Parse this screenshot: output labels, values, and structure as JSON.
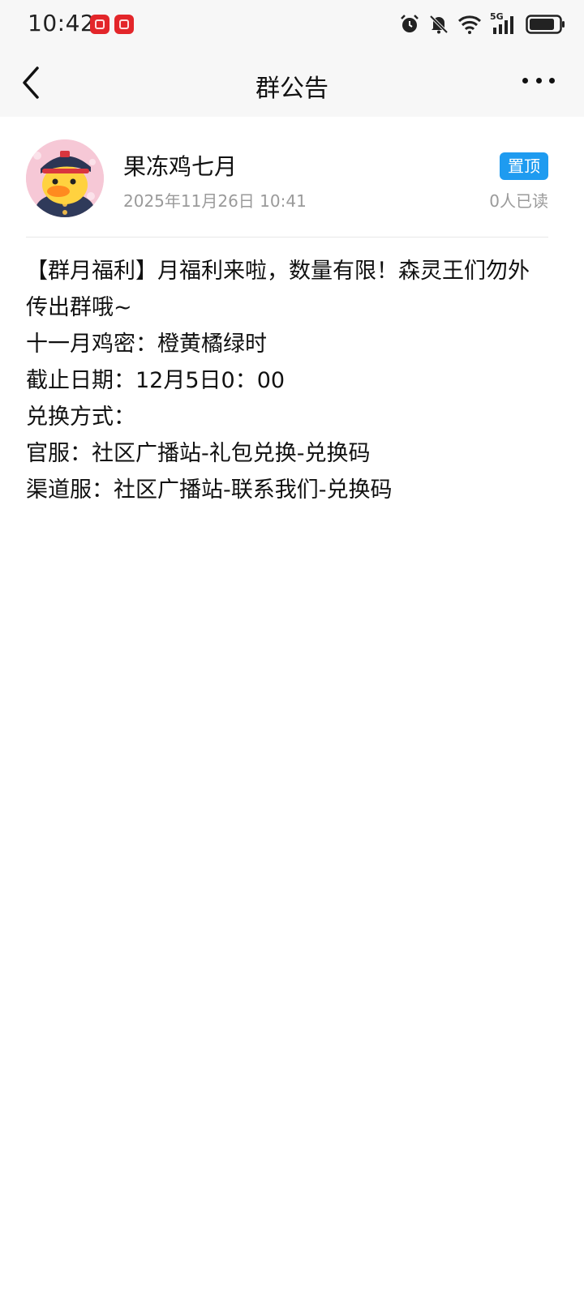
{
  "status_bar": {
    "time": "10:42",
    "network": "5G",
    "icons": [
      "alarm-icon",
      "mute-icon",
      "wifi-icon",
      "signal-icon",
      "battery-icon"
    ]
  },
  "header": {
    "title": "群公告",
    "back_icon": "back-arrow-icon",
    "more_icon": "more-icon"
  },
  "announcement": {
    "author_name": "果冻鸡七月",
    "timestamp": "2025年11月26日 10:41",
    "pin_label": "置顶",
    "read_count": "0人已读",
    "content_lines": [
      "【群月福利】月福利来啦，数量有限！森灵王们勿外传出群哦~",
      "十一月鸡密：橙黄橘绿时",
      "截止日期：12月5日0：00",
      "兑换方式：",
      "官服：社区广播站-礼包兑换-兑换码",
      "渠道服：社区广播站-联系我们-兑换码"
    ]
  },
  "colors": {
    "accent": "#1e9bf0",
    "header_bg": "#f7f7f7",
    "muted_text": "#9a9a9a"
  }
}
